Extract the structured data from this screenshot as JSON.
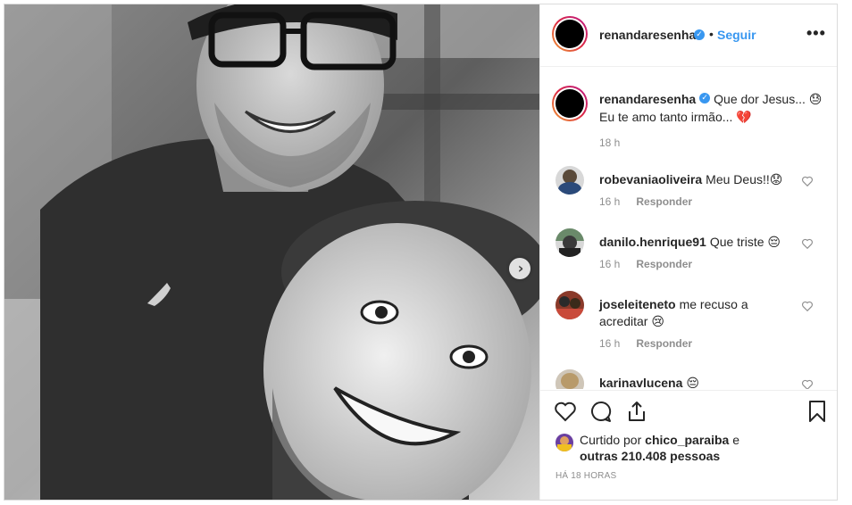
{
  "post": {
    "username": "renandaresenha",
    "follow_label": "Seguir",
    "dot": "•",
    "more": "•••"
  },
  "caption": {
    "username": "renandaresenha",
    "text_line1": "Que dor Jesus... 😓",
    "text_line2": "Eu te amo tanto irmão... 💔",
    "time": "18 h"
  },
  "comments": [
    {
      "username": "robevaniaoliveira",
      "text": "Meu Deus!!😟",
      "time": "16 h",
      "reply": "Responder"
    },
    {
      "username": "danilo.henrique91",
      "text": "Que triste 😔",
      "time": "16 h",
      "reply": "Responder"
    },
    {
      "username": "joseleiteneto",
      "text": "me recuso a acreditar 😢",
      "time": "16 h",
      "reply": "Responder"
    },
    {
      "username": "karinavlucena",
      "text": "😔",
      "time": "",
      "reply": ""
    }
  ],
  "likes": {
    "prefix": "Curtido por",
    "user": "chico_paraiba",
    "conj": "e",
    "others": "outras 210.408 pessoas"
  },
  "timeago": "HÁ 18 HORAS",
  "icons": {
    "verified": "verified-badge-icon",
    "next": "chevron-right-icon",
    "like": "heart-icon",
    "comment": "comment-bubble-icon",
    "share": "share-icon",
    "save": "bookmark-icon",
    "more": "more-options-icon"
  },
  "colors": {
    "accent": "#3897f0",
    "muted": "#8e8e8e",
    "text": "#262626",
    "border": "#dbdbdb"
  }
}
